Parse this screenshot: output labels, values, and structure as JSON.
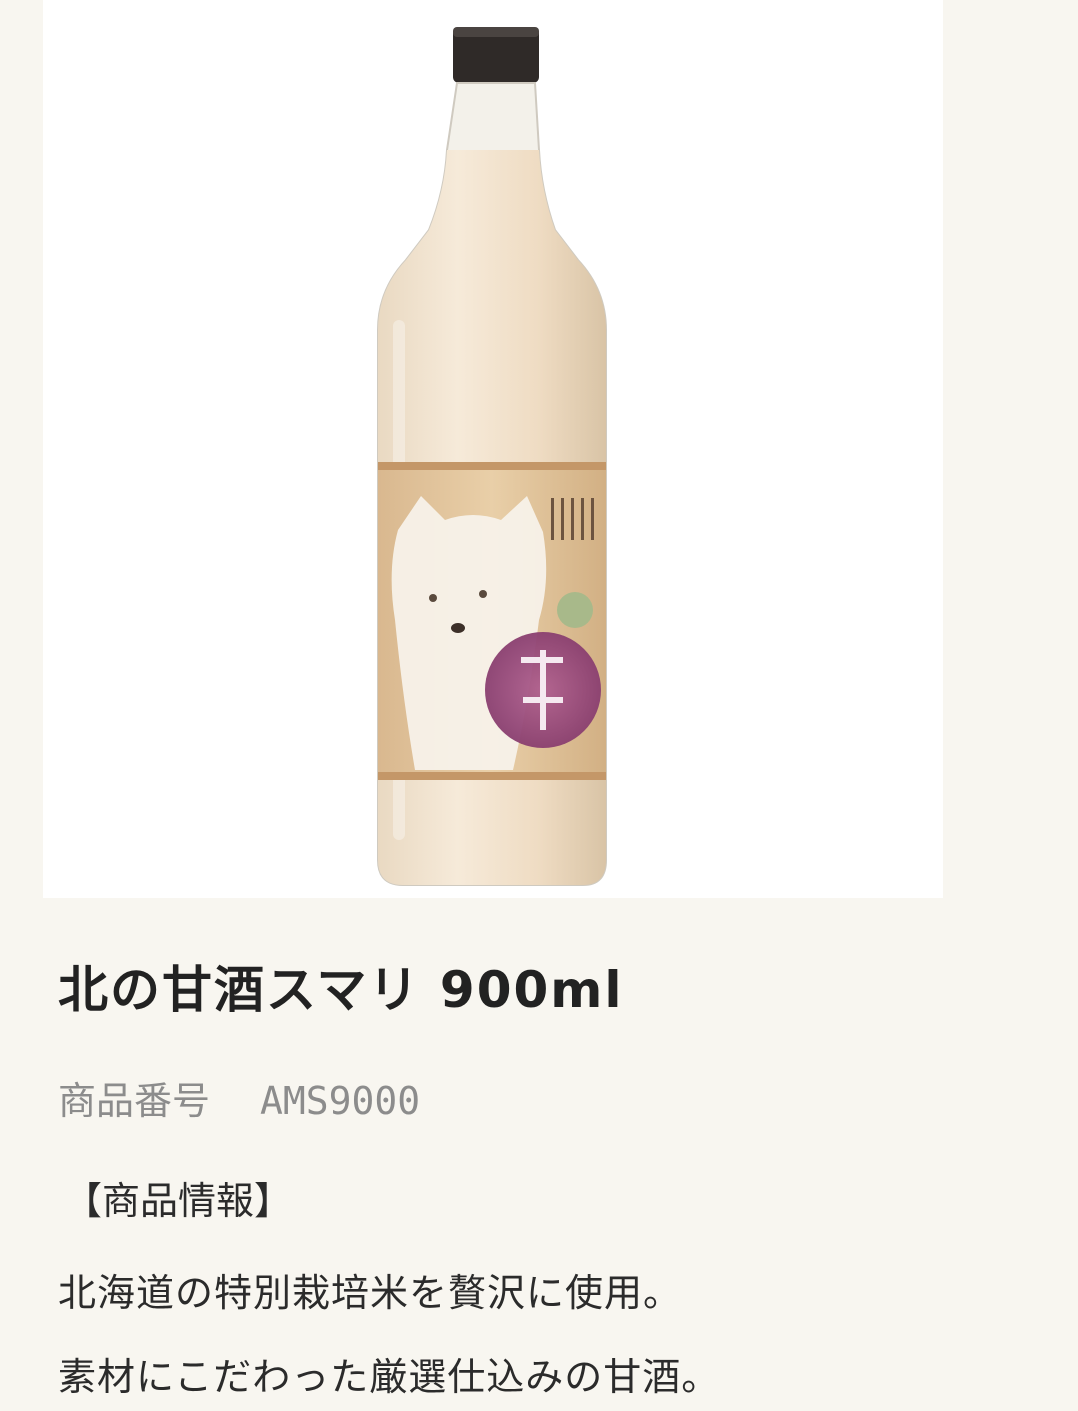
{
  "product": {
    "title": "北の甘酒スマリ 900ml",
    "sku_label": "商品番号",
    "sku_value": "AMS9000",
    "info_heading": "【商品情報】",
    "description": [
      "北海道の特別栽培米を贅沢に使用。",
      "素材にこだわった厳選仕込みの甘酒。"
    ]
  },
  "colors": {
    "page_background": "#f8f6f0",
    "image_background": "#ffffff",
    "title_text": "#222222",
    "sku_text": "#8c8c8c"
  }
}
